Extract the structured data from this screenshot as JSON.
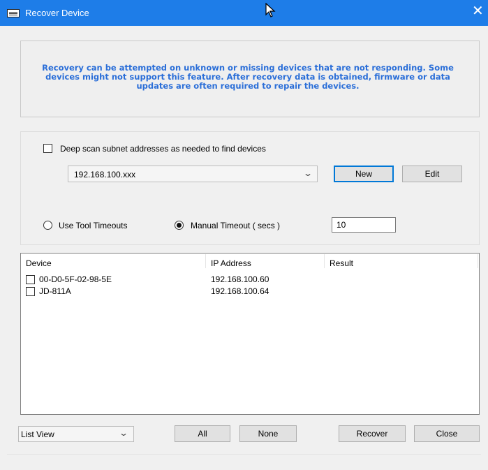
{
  "window": {
    "title": "Recover Device",
    "close_glyph": "✕"
  },
  "info": {
    "text": "Recovery can be attempted on unknown or missing devices that are not responding.  Some devices might not support this feature.  After recovery data is obtained, firmware or data updates are often required to repair the devices."
  },
  "scan": {
    "deep_scan_label": "Deep scan subnet addresses as needed to find devices",
    "deep_scan_checked": false,
    "subnet_value": "192.168.100.xxx",
    "new_label": "New",
    "edit_label": "Edit"
  },
  "timeouts": {
    "tool_label": "Use Tool Timeouts",
    "manual_label": "Manual Timeout ( secs )",
    "selected": "manual",
    "manual_value": "10"
  },
  "table": {
    "columns": [
      "Device",
      "IP Address",
      "Result"
    ],
    "rows": [
      {
        "device": "00-D0-5F-02-98-5E",
        "ip": "192.168.100.60",
        "result": ""
      },
      {
        "device": "JD-811A",
        "ip": "192.168.100.64",
        "result": ""
      }
    ]
  },
  "footer": {
    "view_value": "List View",
    "all_label": "All",
    "none_label": "None",
    "recover_label": "Recover",
    "close_label": "Close"
  },
  "colors": {
    "titlebar": "#1e7de8",
    "info_text": "#2a6ed8",
    "default_button_border": "#0078d7"
  },
  "icons": {
    "app": "window-app-icon",
    "close": "close-icon",
    "dropdown": "chevron-down-icon",
    "pointer": "mouse-cursor-icon"
  }
}
